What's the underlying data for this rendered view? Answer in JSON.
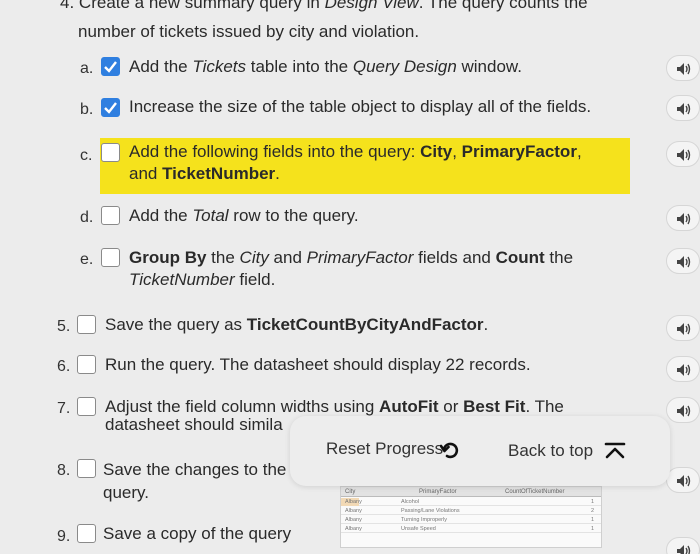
{
  "step4": {
    "number": "4.",
    "line1_parts": [
      "Create a new summary query in ",
      "Design View",
      ". The query counts the"
    ],
    "line2": "number of tickets issued by city and violation."
  },
  "substeps": {
    "a": {
      "letter": "a.",
      "checked": true,
      "parts": [
        "Add the ",
        "Tickets",
        " table into the ",
        "Query Design",
        " window."
      ]
    },
    "b": {
      "letter": "b.",
      "checked": true,
      "text": "Increase the size of the table object to display all of the fields."
    },
    "c": {
      "letter": "c.",
      "checked": false,
      "line1_parts": [
        "Add the following fields into the query: ",
        "City",
        ", ",
        "PrimaryFactor",
        ","
      ],
      "line2_parts": [
        "and ",
        "TicketNumber",
        "."
      ]
    },
    "d": {
      "letter": "d.",
      "checked": false,
      "parts": [
        "Add the ",
        "Total",
        " row to the query."
      ]
    },
    "e": {
      "letter": "e.",
      "checked": false,
      "line1_parts": [
        "Group By",
        " the ",
        "City",
        " and ",
        "PrimaryFactor",
        " fields and ",
        "Count",
        " the"
      ],
      "line2_parts": [
        "TicketNumber",
        " field."
      ]
    }
  },
  "steps": {
    "s5": {
      "number": "5.",
      "checked": false,
      "parts": [
        "Save the query as ",
        "TicketCountByCityAndFactor",
        "."
      ]
    },
    "s6": {
      "number": "6.",
      "checked": false,
      "text": "Run the query. The datasheet should display 22 records."
    },
    "s7": {
      "number": "7.",
      "checked": false,
      "line1_parts": [
        "Adjust the field column widths using ",
        "AutoFit",
        " or ",
        "Best Fit",
        ". The"
      ],
      "line2": "datasheet should simila"
    },
    "s8": {
      "number": "8.",
      "checked": false,
      "line1": "Save the changes to the",
      "line2": "query."
    },
    "s9": {
      "number": "9.",
      "checked": false,
      "text": "Save a copy of the query"
    }
  },
  "toolbar": {
    "reset_label": "Reset Progress",
    "back_to_top_label": "Back to top"
  },
  "datasheet_preview": {
    "headers": [
      "City",
      "PrimaryFactor",
      "CountOfTicketNumber"
    ],
    "rows": [
      [
        "Albany",
        "Alcohol",
        "1"
      ],
      [
        "Albany",
        "Passing/Lane Violations",
        "2"
      ],
      [
        "Albany",
        "Turning Improperly",
        "1"
      ],
      [
        "Albany",
        "Unsafe Speed",
        "1"
      ]
    ]
  },
  "colors": {
    "checkbox_checked": "#2f7fe0",
    "highlight": "#f5e21c",
    "background": "#ececec"
  },
  "icons": {
    "audio": "speaker-icon",
    "reset": "undo-arrow-icon",
    "back_to_top": "arrow-up-to-line-icon",
    "check": "checkmark-icon"
  }
}
